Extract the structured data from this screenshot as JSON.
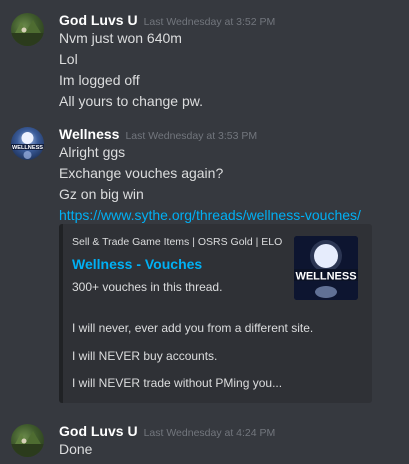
{
  "messages": [
    {
      "author": "God Luvs U",
      "timestamp": "Last Wednesday at 3:52 PM",
      "avatar_icon": "landscape-avatar",
      "lines": [
        "Nvm just won 640m",
        "Lol",
        "Im logged off",
        "All yours to change pw."
      ]
    },
    {
      "author": "Wellness",
      "timestamp": "Last Wednesday at 3:53 PM",
      "avatar_icon": "moon-avatar",
      "avatar_text": "WELLNESS",
      "lines": [
        "Alright ggs",
        "Exchange vouches again?",
        "Gz on big win"
      ],
      "link": "https://www.sythe.org/threads/wellness-vouches/",
      "embed": {
        "provider": "Sell & Trade Game Items | OSRS Gold | ELO",
        "title": "Wellness - Vouches",
        "description": [
          "300+ vouches in this thread.",
          "I will never, ever add you from a different site.",
          "I will NEVER buy accounts.",
          "I will NEVER trade without PMing you..."
        ],
        "thumbnail_text": "WELLNESS"
      }
    },
    {
      "author": "God Luvs U",
      "timestamp": "Last Wednesday at 4:24 PM",
      "avatar_icon": "landscape-avatar",
      "lines": [
        "Done"
      ]
    }
  ],
  "colors": {
    "background": "#36393f",
    "username": "#ffffff",
    "timestamp": "#72767d",
    "link": "#00b0f4",
    "embed_bg": "#2f3136"
  }
}
